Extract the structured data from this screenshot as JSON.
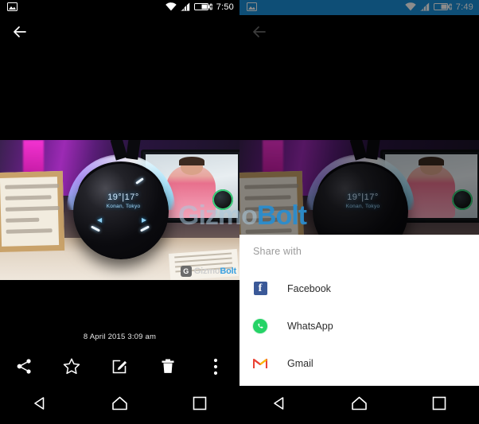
{
  "left_phone": {
    "status_bar": {
      "notification_icon": "image-icon",
      "wifi_icon": "wifi-icon",
      "signal_icon": "cellular-signal-icon",
      "battery_icon": "battery-charging-icon",
      "time": "7:50",
      "background": "#000000"
    },
    "app_bar": {
      "back_icon": "arrow-left-icon"
    },
    "photo": {
      "orb_temperature": "19°|17°",
      "orb_location": "Konan, Tokyo",
      "watermark_text_primary": "Gizmo",
      "watermark_text_secondary": "Bolt",
      "watermark_badge": "G"
    },
    "metadata": {
      "date_time": "8 April 2015 3:09 am"
    },
    "toolbar": [
      {
        "name": "share-button",
        "icon": "share-icon"
      },
      {
        "name": "favorite-button",
        "icon": "star-outline-icon"
      },
      {
        "name": "edit-button",
        "icon": "edit-square-icon"
      },
      {
        "name": "delete-button",
        "icon": "trash-icon"
      },
      {
        "name": "overflow-button",
        "icon": "more-vertical-icon"
      }
    ],
    "nav_bar": [
      {
        "name": "nav-back",
        "icon": "triangle-back-icon"
      },
      {
        "name": "nav-home",
        "icon": "home-icon"
      },
      {
        "name": "nav-recents",
        "icon": "square-recents-icon"
      }
    ]
  },
  "right_phone": {
    "status_bar": {
      "notification_icon": "image-icon",
      "wifi_icon": "wifi-icon",
      "signal_icon": "cellular-signal-icon",
      "battery_icon": "battery-charging-icon",
      "time": "7:49",
      "background": "#1a8fd8"
    },
    "app_bar": {
      "back_icon": "arrow-left-icon"
    },
    "share_sheet": {
      "title": "Share with",
      "items": [
        {
          "label": "Facebook",
          "icon": "facebook-icon",
          "color": "#3b5998"
        },
        {
          "label": "WhatsApp",
          "icon": "whatsapp-icon",
          "color": "#25d366"
        },
        {
          "label": "Gmail",
          "icon": "gmail-icon",
          "color": "#ea4335"
        }
      ]
    },
    "nav_bar": [
      {
        "name": "nav-back",
        "icon": "triangle-back-icon"
      },
      {
        "name": "nav-home",
        "icon": "home-icon"
      },
      {
        "name": "nav-recents",
        "icon": "square-recents-icon"
      }
    ]
  },
  "global_watermark": {
    "part1": "Gizmo",
    "part2": "Bolt"
  }
}
